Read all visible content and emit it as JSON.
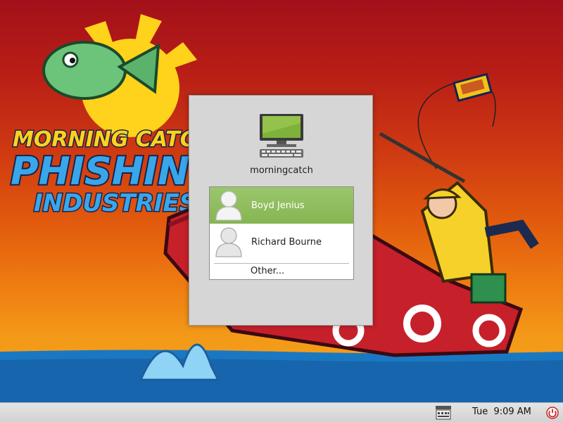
{
  "wallpaper": {
    "logo_line1": "MORNING CATCH",
    "logo_line2": "PHISHING",
    "logo_line3": "INDUSTRIES"
  },
  "login": {
    "hostname": "morningcatch",
    "users": [
      {
        "name": "Boyd Jenius",
        "selected": true
      },
      {
        "name": "Richard Bourne",
        "selected": false
      }
    ],
    "other_label": "Other...",
    "selection_color": "#8ebb5c"
  },
  "panel": {
    "clock": "Tue  9:09 AM",
    "icons": [
      "keyboard-icon",
      "power-icon"
    ],
    "power_color": "#cc2222"
  }
}
